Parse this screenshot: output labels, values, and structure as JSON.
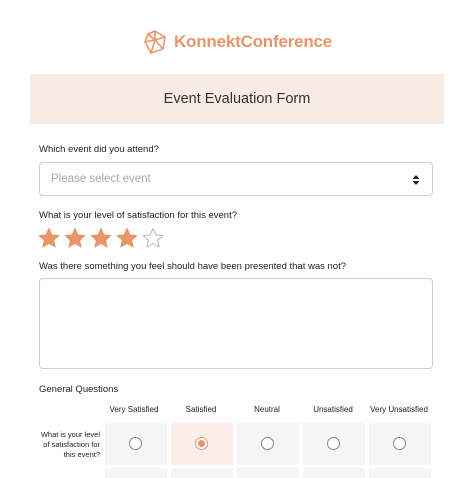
{
  "brand": {
    "name": "KonnektConference",
    "accent": "#e8956a"
  },
  "form": {
    "title": "Event Evaluation Form"
  },
  "questions": {
    "event": {
      "label": "Which event did you attend?",
      "placeholder": "Please select event"
    },
    "satisfaction": {
      "label": "What is your level of satisfaction for this event?",
      "rating": 4,
      "max": 5
    },
    "missing": {
      "label": "Was there something you feel should have been presented that was not?"
    }
  },
  "matrix": {
    "title": "General Questions",
    "columns": [
      "Very Satisfied",
      "Satisfied",
      "Neutral",
      "Unsatisfied",
      "Very Unsatisfied"
    ],
    "rows": [
      {
        "label": "What is your level of satisfaction for this event?",
        "selected": 1
      }
    ]
  },
  "icons": {
    "logo": "geodesic-logo-icon",
    "select": "sort-arrows-icon",
    "star": "star-icon"
  }
}
